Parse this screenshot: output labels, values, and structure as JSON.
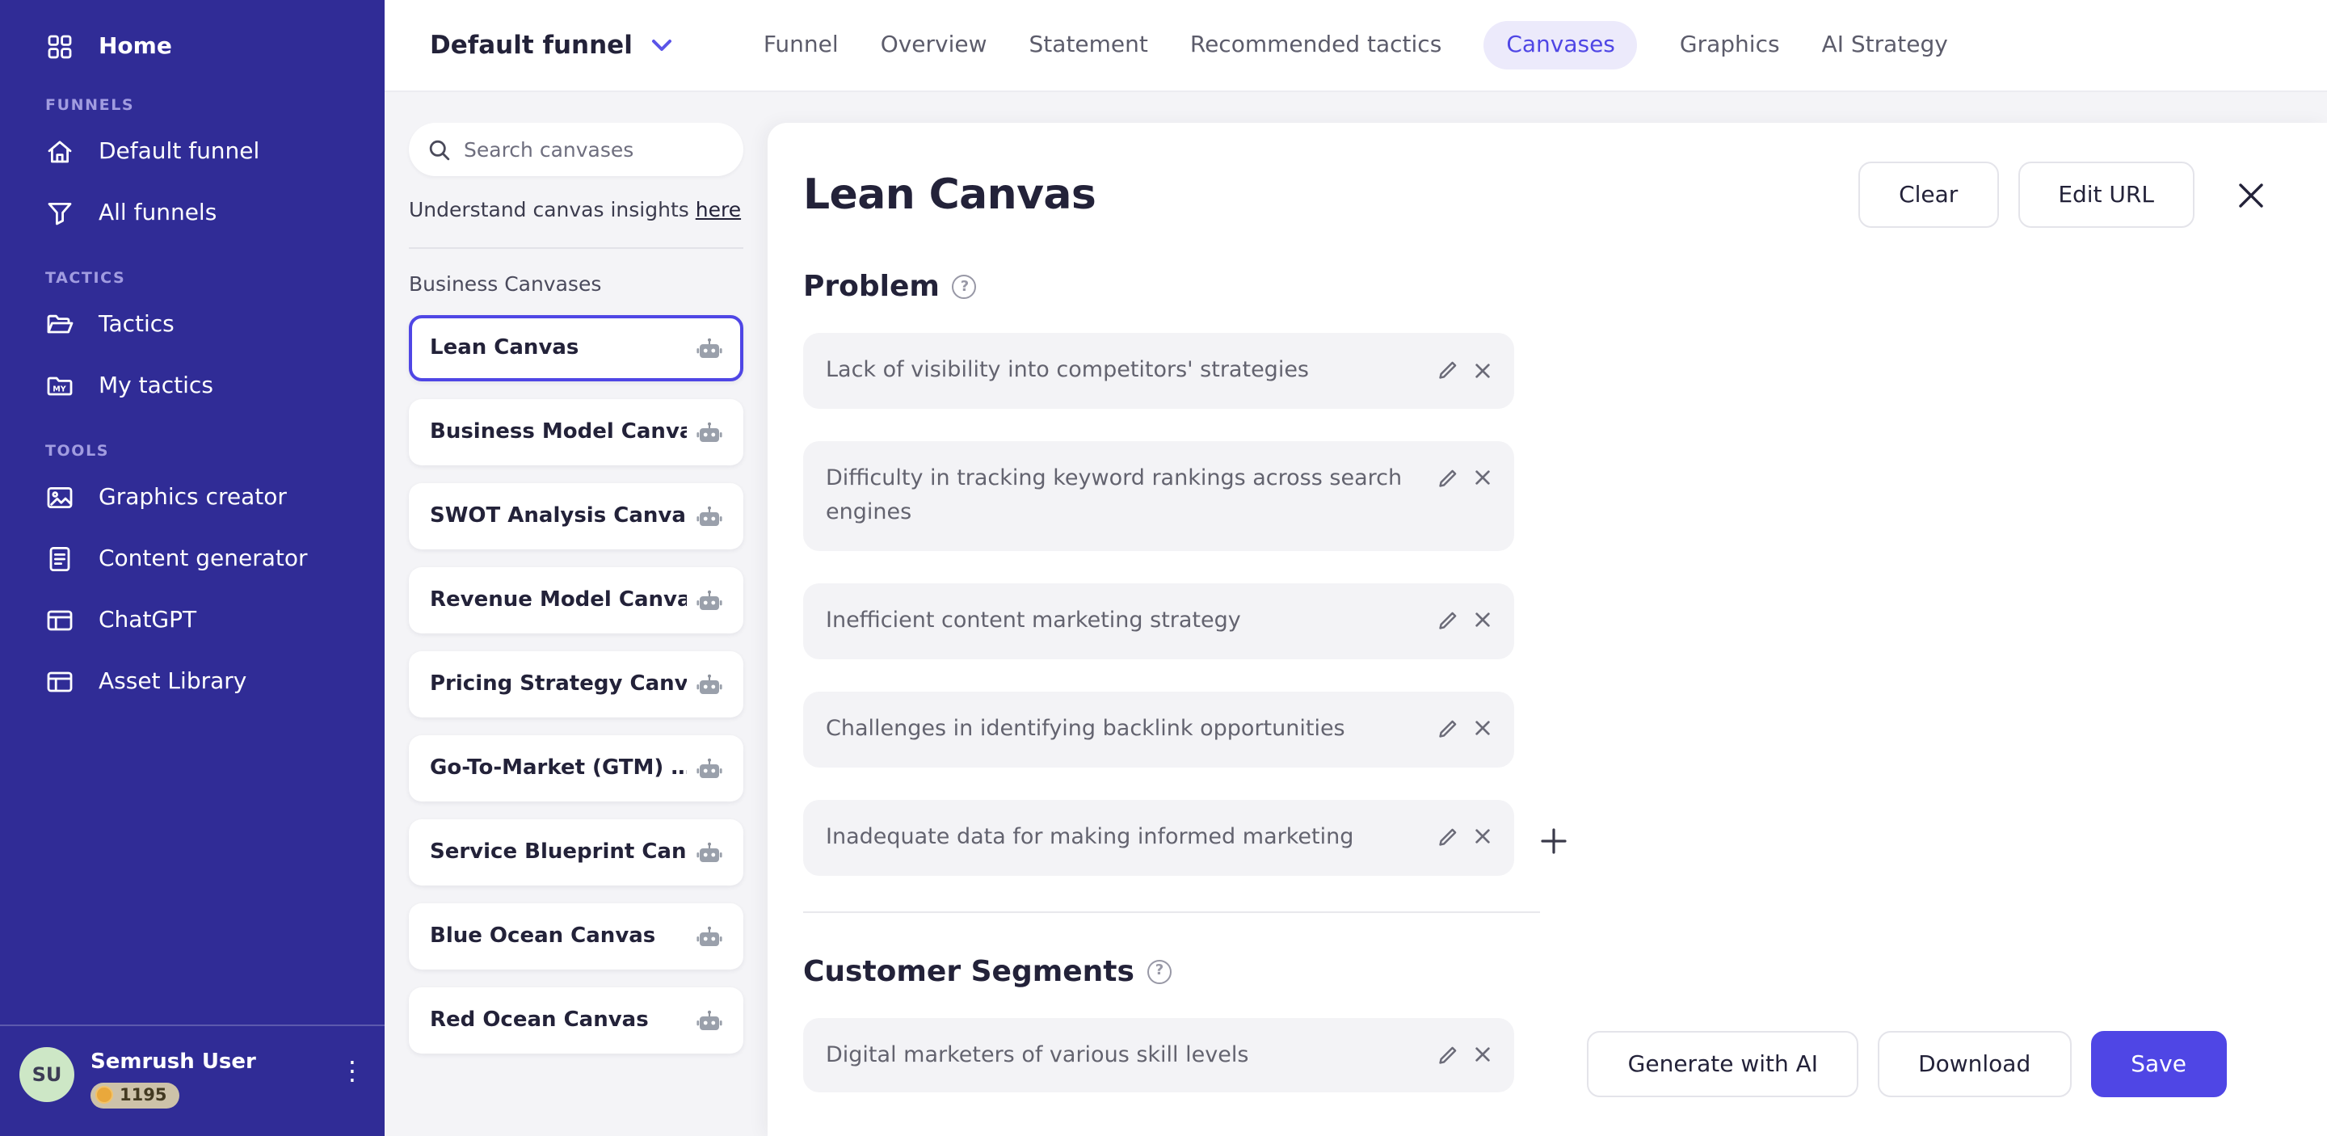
{
  "colors": {
    "sidebar_bg": "#302c96",
    "accent": "#4f46e5",
    "active_tab_bg": "#eceafb",
    "page_bg": "#f4f4f7",
    "row_bg": "#f3f3f6",
    "avatar_bg": "#cde7c6",
    "credit_pill_bg": "#cdc2a9"
  },
  "icons": {
    "help": "?",
    "kebab": "⋮"
  },
  "sidebar": {
    "home_label": "Home",
    "sections": [
      {
        "label": "FUNNELS",
        "items": [
          {
            "label": "Default funnel",
            "icon": "home-icon"
          },
          {
            "label": "All funnels",
            "icon": "funnel-icon"
          }
        ]
      },
      {
        "label": "TACTICS",
        "items": [
          {
            "label": "Tactics",
            "icon": "folder-open-icon"
          },
          {
            "label": "My tactics",
            "icon": "folder-my-icon"
          }
        ]
      },
      {
        "label": "TOOLS",
        "items": [
          {
            "label": "Graphics creator",
            "icon": "image-icon"
          },
          {
            "label": "Content generator",
            "icon": "document-icon"
          },
          {
            "label": "ChatGPT",
            "icon": "window-icon"
          },
          {
            "label": "Asset Library",
            "icon": "window-icon"
          }
        ]
      }
    ],
    "user": {
      "initials": "SU",
      "name": "Semrush User",
      "credits": "1195"
    }
  },
  "topbar": {
    "funnel_selector": "Default funnel",
    "tabs": [
      {
        "label": "Funnel",
        "active": false
      },
      {
        "label": "Overview",
        "active": false
      },
      {
        "label": "Statement",
        "active": false
      },
      {
        "label": "Recommended tactics",
        "active": false
      },
      {
        "label": "Canvases",
        "active": true
      },
      {
        "label": "Graphics",
        "active": false
      },
      {
        "label": "AI Strategy",
        "active": false
      }
    ]
  },
  "canvas_panel": {
    "search_placeholder": "Search canvases",
    "insights_text": "Understand canvas insights",
    "insights_link": "here",
    "group_label": "Business Canvases",
    "canvases": [
      {
        "label": "Lean Canvas",
        "selected": true
      },
      {
        "label": "Business Model Canvas",
        "selected": false
      },
      {
        "label": "SWOT Analysis Canvas",
        "selected": false
      },
      {
        "label": "Revenue Model Canvas",
        "selected": false
      },
      {
        "label": "Pricing Strategy Canv…",
        "selected": false
      },
      {
        "label": "Go-To-Market (GTM) …",
        "selected": false
      },
      {
        "label": "Service Blueprint Can…",
        "selected": false
      },
      {
        "label": "Blue Ocean Canvas",
        "selected": false
      },
      {
        "label": "Red Ocean Canvas",
        "selected": false
      }
    ]
  },
  "main": {
    "title": "Lean Canvas",
    "clear_label": "Clear",
    "edit_url_label": "Edit URL",
    "sections": [
      {
        "heading": "Problem",
        "items": [
          "Lack of visibility into competitors' strategies",
          "Difficulty in tracking keyword rankings across search engines",
          "Inefficient content marketing strategy",
          "Challenges in identifying backlink opportunities",
          "Inadequate data for making informed marketing"
        ]
      },
      {
        "heading": "Customer Segments",
        "items": [
          "Digital marketers of various skill levels"
        ]
      }
    ],
    "footer": {
      "generate": "Generate with AI",
      "download": "Download",
      "save": "Save"
    }
  }
}
